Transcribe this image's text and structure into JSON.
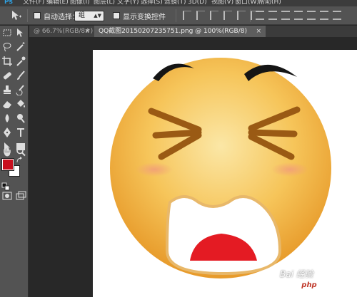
{
  "app": {
    "logo": "Ps"
  },
  "menu": [
    "文件(F)",
    "编辑(E)",
    "图像(I)",
    "图层(L)",
    "文字(Y)",
    "选择(S)",
    "滤镜(T)",
    "3D(D)",
    "视图(V)",
    "窗口(W)",
    "帮助(H)"
  ],
  "options": {
    "auto_select_label": "自动选择：",
    "auto_select_value": "组",
    "show_transform_label": "显示变换控件"
  },
  "tabs": [
    {
      "label": "@ 66.7%(RGB/8#) *",
      "active": false
    },
    {
      "label": "QQ截图20150207235751.png @ 100%(RGB/8)",
      "active": true
    }
  ],
  "colors": {
    "foreground": "#c8101e",
    "background": "#ffffff",
    "accent": "#2fa4e7"
  },
  "tools": [
    "marquee-icon",
    "move-icon",
    "lasso-icon",
    "magic-wand-icon",
    "crop-icon",
    "eyedropper-icon",
    "healing-icon",
    "brush-icon",
    "stamp-icon",
    "history-brush-icon",
    "eraser-icon",
    "paint-bucket-icon",
    "blur-icon",
    "dodge-icon",
    "pen-icon",
    "type-icon",
    "path-select-icon",
    "shape-icon",
    "hand-icon",
    "zoom-icon"
  ],
  "watermark": {
    "baidu": "Bai 经验",
    "php_logo": "php",
    "php_text": "中文网"
  }
}
